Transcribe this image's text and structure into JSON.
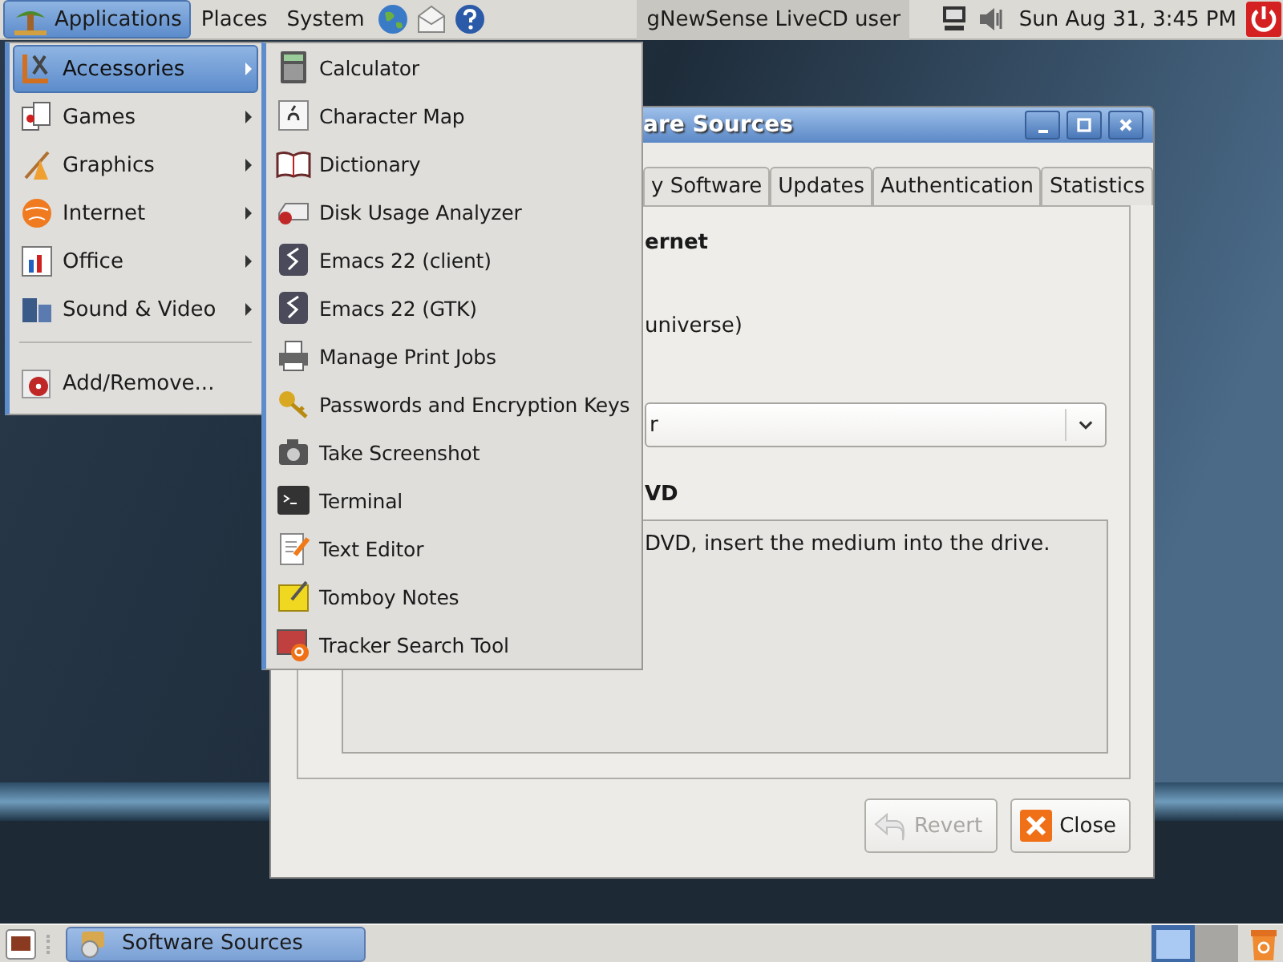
{
  "top_panel": {
    "menus": [
      {
        "label": "Applications",
        "selected": true
      },
      {
        "label": "Places",
        "selected": false
      },
      {
        "label": "System",
        "selected": false
      }
    ],
    "user": "gNewSense LiveCD user",
    "clock": "Sun Aug 31,  3:45 PM"
  },
  "applications_menu": {
    "items": [
      {
        "kind": "category",
        "label": "Accessories",
        "selected": true
      },
      {
        "kind": "category",
        "label": "Games",
        "selected": false
      },
      {
        "kind": "category",
        "label": "Graphics",
        "selected": false
      },
      {
        "kind": "category",
        "label": "Internet",
        "selected": false
      },
      {
        "kind": "category",
        "label": "Office",
        "selected": false
      },
      {
        "kind": "category",
        "label": "Sound & Video",
        "selected": false
      },
      {
        "kind": "separator"
      },
      {
        "kind": "action",
        "label": "Add/Remove...",
        "selected": false
      }
    ]
  },
  "accessories_submenu": {
    "items": [
      "Calculator",
      "Character Map",
      "Dictionary",
      "Disk Usage Analyzer",
      "Emacs 22 (client)",
      "Emacs 22 (GTK)",
      "Manage Print Jobs",
      "Passwords and Encryption Keys",
      "Take Screenshot",
      "Terminal",
      "Text Editor",
      "Tomboy Notes",
      "Tracker Search Tool"
    ]
  },
  "dialog": {
    "title": "are Sources",
    "tabs": [
      {
        "label": "y Software",
        "selected": false
      },
      {
        "label": "Updates",
        "selected": false
      },
      {
        "label": "Authentication",
        "selected": false
      },
      {
        "label": "Statistics",
        "selected": false
      }
    ],
    "heading_1": "ernet",
    "option": "universe)",
    "combo_value": "r",
    "heading_2": "VD",
    "note": "DVD, insert the medium into the drive.",
    "buttons": [
      {
        "kind": "revert",
        "label": "Revert",
        "disabled": true
      },
      {
        "kind": "close",
        "label": "Close",
        "disabled": false
      }
    ]
  },
  "bottom_panel": {
    "tasks": [
      {
        "label": "Software Sources",
        "selected": true
      }
    ],
    "workspaces": [
      {
        "selected": true
      },
      {
        "selected": false
      }
    ]
  }
}
